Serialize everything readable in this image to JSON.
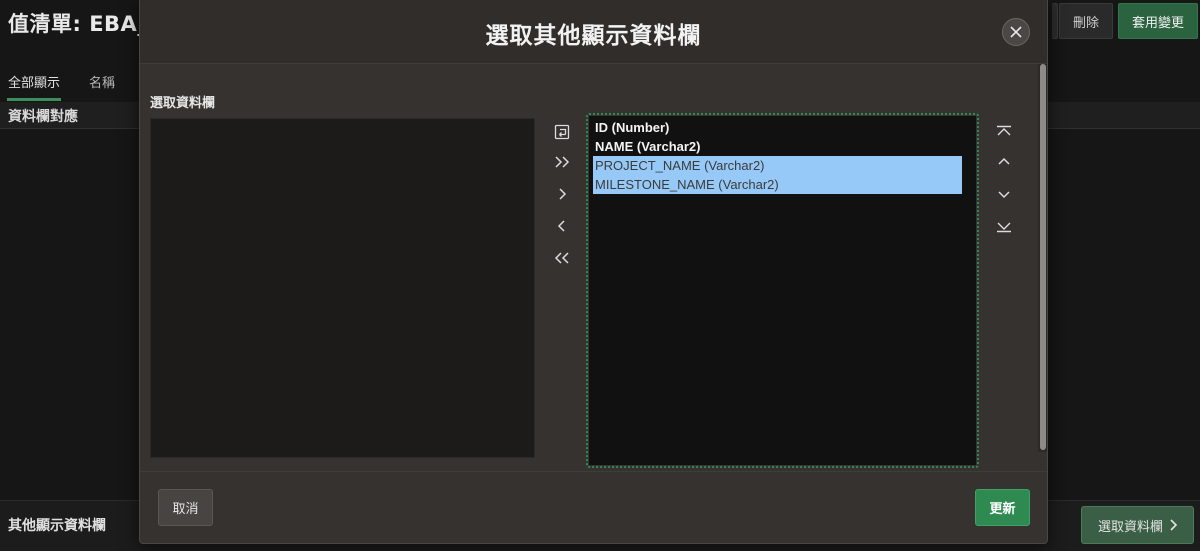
{
  "background": {
    "title": "值清單: EBA_",
    "buttons": {
      "delete": "刪除",
      "apply": "套用變更"
    },
    "tabs": [
      {
        "label": "全部顯示"
      },
      {
        "label": "名稱"
      }
    ],
    "section_title": "資料欄對應",
    "footer": {
      "label": "其他顯示資料欄",
      "button": "選取資料欄"
    }
  },
  "dialog": {
    "title": "選取其他顯示資料欄",
    "available_label": "選取資料欄",
    "available_items": [],
    "selected_items": [
      {
        "label": "ID (Number)",
        "selected": false
      },
      {
        "label": "NAME (Varchar2)",
        "selected": false
      },
      {
        "label": "PROJECT_NAME (Varchar2)",
        "selected": true
      },
      {
        "label": "MILESTONE_NAME (Varchar2)",
        "selected": true
      }
    ],
    "cancel_label": "取消",
    "update_label": "更新"
  },
  "colors": {
    "accent_green": "#2f8a52",
    "selection_blue": "#96c9f7",
    "dialog_bg": "#353230",
    "page_bg": "#161616"
  },
  "icons": {
    "close": "close-icon",
    "reset": "reset-icon",
    "move_all_right": "double-chevron-right-icon",
    "move_right": "chevron-right-icon",
    "move_left": "chevron-left-icon",
    "move_all_left": "double-chevron-left-icon",
    "move_top": "move-top-icon",
    "move_up": "chevron-up-icon",
    "move_down": "chevron-down-icon",
    "move_bottom": "move-bottom-icon"
  }
}
